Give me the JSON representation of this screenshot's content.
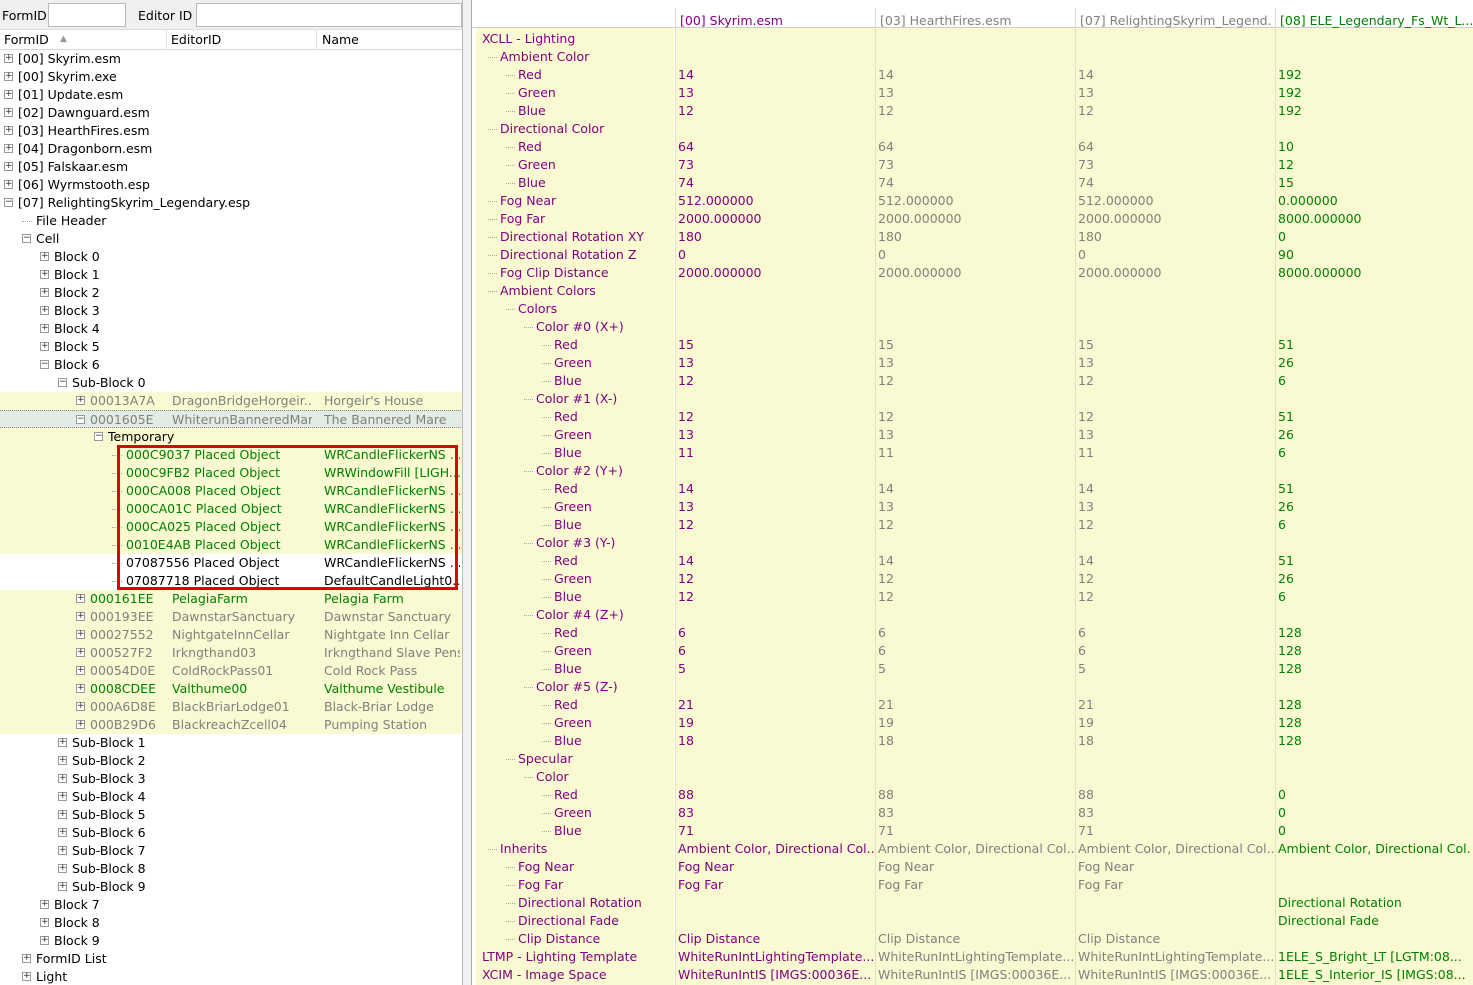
{
  "filter": {
    "formid_label": "FormID",
    "editorid_label": "Editor ID",
    "formid_value": "",
    "editorid_value": ""
  },
  "left_header": {
    "formid": "FormID",
    "editorid": "EditorID",
    "name": "Name"
  },
  "tree": [
    {
      "t": "p",
      "d": 0,
      "text": "[00] Skyrim.esm"
    },
    {
      "t": "p",
      "d": 0,
      "text": "[00] Skyrim.exe"
    },
    {
      "t": "p",
      "d": 0,
      "text": "[01] Update.esm"
    },
    {
      "t": "p",
      "d": 0,
      "text": "[02] Dawnguard.esm"
    },
    {
      "t": "p",
      "d": 0,
      "text": "[03] HearthFires.esm"
    },
    {
      "t": "p",
      "d": 0,
      "text": "[04] Dragonborn.esm"
    },
    {
      "t": "p",
      "d": 0,
      "text": "[05] Falskaar.esm"
    },
    {
      "t": "p",
      "d": 0,
      "text": "[06] Wyrmstooth.esp"
    },
    {
      "t": "m",
      "d": 0,
      "text": "[07] RelightingSkyrim_Legendary.esp"
    },
    {
      "t": "n",
      "d": 1,
      "text": "File Header"
    },
    {
      "t": "m",
      "d": 1,
      "text": "Cell"
    },
    {
      "t": "p",
      "d": 2,
      "text": "Block 0"
    },
    {
      "t": "p",
      "d": 2,
      "text": "Block 1"
    },
    {
      "t": "p",
      "d": 2,
      "text": "Block 2"
    },
    {
      "t": "p",
      "d": 2,
      "text": "Block 3"
    },
    {
      "t": "p",
      "d": 2,
      "text": "Block 4"
    },
    {
      "t": "p",
      "d": 2,
      "text": "Block 5"
    },
    {
      "t": "m",
      "d": 2,
      "text": "Block 6"
    },
    {
      "t": "m",
      "d": 3,
      "text": "Sub-Block 0"
    },
    {
      "t": "p",
      "d": 4,
      "text": "00013A7A",
      "c2": "DragonBridgeHorgeir...",
      "c3": "Horgeir's House",
      "col": "gray",
      "hl": true
    },
    {
      "t": "m",
      "d": 4,
      "text": "0001605E",
      "c2": "WhiterunBanneredMare",
      "c3": "The Bannered Mare",
      "col": "gray",
      "sel": true
    },
    {
      "t": "m",
      "d": 5,
      "text": "Temporary",
      "hl": true
    },
    {
      "t": "n",
      "d": 6,
      "text": "000C9037  Placed Object",
      "c3": "WRCandleFlickerNS ...",
      "col": "green",
      "hl": true
    },
    {
      "t": "n",
      "d": 6,
      "text": "000C9FB2  Placed Object",
      "c3": "WRWindowFill [LIGH...",
      "col": "green",
      "hl": true
    },
    {
      "t": "n",
      "d": 6,
      "text": "000CA008  Placed Object",
      "c3": "WRCandleFlickerNS ...",
      "col": "green",
      "hl": true
    },
    {
      "t": "n",
      "d": 6,
      "text": "000CA01C  Placed Object",
      "c3": "WRCandleFlickerNS ...",
      "col": "green",
      "hl": true
    },
    {
      "t": "n",
      "d": 6,
      "text": "000CA025  Placed Object",
      "c3": "WRCandleFlickerNS ...",
      "col": "green",
      "hl": true
    },
    {
      "t": "n",
      "d": 6,
      "text": "0010E4AB  Placed Object",
      "c3": "WRCandleFlickerNS ...",
      "col": "green",
      "hl": true
    },
    {
      "t": "n",
      "d": 6,
      "text": "07087556  Placed Object",
      "c3": "WRCandleFlickerNS ..."
    },
    {
      "t": "n",
      "d": 6,
      "text": "07087718  Placed Object",
      "c3": "DefaultCandleLight0..."
    },
    {
      "t": "p",
      "d": 4,
      "text": "000161EE",
      "c2": "PelagiaFarm",
      "c3": "Pelagia Farm",
      "col": "green",
      "hl": true
    },
    {
      "t": "p",
      "d": 4,
      "text": "000193EE",
      "c2": "DawnstarSanctuary",
      "c3": "Dawnstar Sanctuary",
      "col": "gray",
      "hl": true
    },
    {
      "t": "p",
      "d": 4,
      "text": "00027552",
      "c2": "NightgateInnCellar",
      "c3": "Nightgate Inn Cellar",
      "col": "gray",
      "hl": true
    },
    {
      "t": "p",
      "d": 4,
      "text": "000527F2",
      "c2": "Irkngthand03",
      "c3": "Irkngthand Slave Pens",
      "col": "gray",
      "hl": true
    },
    {
      "t": "p",
      "d": 4,
      "text": "00054D0E",
      "c2": "ColdRockPass01",
      "c3": "Cold Rock Pass",
      "col": "gray",
      "hl": true
    },
    {
      "t": "p",
      "d": 4,
      "text": "0008CDEE",
      "c2": "Valthume00",
      "c3": "Valthume Vestibule",
      "col": "green",
      "hl": true
    },
    {
      "t": "p",
      "d": 4,
      "text": "000A6D8E",
      "c2": "BlackBriarLodge01",
      "c3": "Black-Briar Lodge",
      "col": "gray",
      "hl": true
    },
    {
      "t": "p",
      "d": 4,
      "text": "000B29D6",
      "c2": "BlackreachZcell04",
      "c3": "Pumping Station",
      "col": "gray",
      "hl": true
    },
    {
      "t": "p",
      "d": 3,
      "text": "Sub-Block 1"
    },
    {
      "t": "p",
      "d": 3,
      "text": "Sub-Block 2"
    },
    {
      "t": "p",
      "d": 3,
      "text": "Sub-Block 3"
    },
    {
      "t": "p",
      "d": 3,
      "text": "Sub-Block 4"
    },
    {
      "t": "p",
      "d": 3,
      "text": "Sub-Block 5"
    },
    {
      "t": "p",
      "d": 3,
      "text": "Sub-Block 6"
    },
    {
      "t": "p",
      "d": 3,
      "text": "Sub-Block 7"
    },
    {
      "t": "p",
      "d": 3,
      "text": "Sub-Block 8"
    },
    {
      "t": "p",
      "d": 3,
      "text": "Sub-Block 9"
    },
    {
      "t": "p",
      "d": 2,
      "text": "Block 7"
    },
    {
      "t": "p",
      "d": 2,
      "text": "Block 8"
    },
    {
      "t": "p",
      "d": 2,
      "text": "Block 9"
    },
    {
      "t": "p",
      "d": 1,
      "text": "FormID List"
    },
    {
      "t": "p",
      "d": 1,
      "text": "Light"
    }
  ],
  "right_header": [
    "[00] Skyrim.esm",
    "[03] HearthFires.esm",
    "[07] RelightingSkyrim_Legend...",
    "[08] ELE_Legendary_Fs_Wt_L..."
  ],
  "right_header_colors": [
    "#800080",
    "#808080",
    "#808080",
    "#008000"
  ],
  "grid": [
    {
      "d": 0,
      "name": "XCLL - Lighting",
      "v": [
        "",
        "",
        "",
        ""
      ]
    },
    {
      "d": 1,
      "name": "Ambient Color",
      "v": [
        "",
        "",
        "",
        ""
      ]
    },
    {
      "d": 2,
      "name": "Red",
      "v": [
        "14",
        "14",
        "14",
        "192"
      ]
    },
    {
      "d": 2,
      "name": "Green",
      "v": [
        "13",
        "13",
        "13",
        "192"
      ]
    },
    {
      "d": 2,
      "name": "Blue",
      "v": [
        "12",
        "12",
        "12",
        "192"
      ]
    },
    {
      "d": 1,
      "name": "Directional Color",
      "v": [
        "",
        "",
        "",
        ""
      ]
    },
    {
      "d": 2,
      "name": "Red",
      "v": [
        "64",
        "64",
        "64",
        "10"
      ]
    },
    {
      "d": 2,
      "name": "Green",
      "v": [
        "73",
        "73",
        "73",
        "12"
      ]
    },
    {
      "d": 2,
      "name": "Blue",
      "v": [
        "74",
        "74",
        "74",
        "15"
      ]
    },
    {
      "d": 1,
      "name": "Fog Near",
      "v": [
        "512.000000",
        "512.000000",
        "512.000000",
        "0.000000"
      ]
    },
    {
      "d": 1,
      "name": "Fog Far",
      "v": [
        "2000.000000",
        "2000.000000",
        "2000.000000",
        "8000.000000"
      ]
    },
    {
      "d": 1,
      "name": "Directional Rotation XY",
      "v": [
        "180",
        "180",
        "180",
        "0"
      ]
    },
    {
      "d": 1,
      "name": "Directional Rotation Z",
      "v": [
        "0",
        "0",
        "0",
        "90"
      ]
    },
    {
      "d": 1,
      "name": "Fog Clip Distance",
      "v": [
        "2000.000000",
        "2000.000000",
        "2000.000000",
        "8000.000000"
      ]
    },
    {
      "d": 1,
      "name": "Ambient Colors",
      "v": [
        "",
        "",
        "",
        ""
      ]
    },
    {
      "d": 2,
      "name": "Colors",
      "v": [
        "",
        "",
        "",
        ""
      ]
    },
    {
      "d": 3,
      "name": "Color #0 (X+)",
      "v": [
        "",
        "",
        "",
        ""
      ]
    },
    {
      "d": 4,
      "name": "Red",
      "v": [
        "15",
        "15",
        "15",
        "51"
      ]
    },
    {
      "d": 4,
      "name": "Green",
      "v": [
        "13",
        "13",
        "13",
        "26"
      ]
    },
    {
      "d": 4,
      "name": "Blue",
      "v": [
        "12",
        "12",
        "12",
        "6"
      ]
    },
    {
      "d": 3,
      "name": "Color #1 (X-)",
      "v": [
        "",
        "",
        "",
        ""
      ]
    },
    {
      "d": 4,
      "name": "Red",
      "v": [
        "12",
        "12",
        "12",
        "51"
      ]
    },
    {
      "d": 4,
      "name": "Green",
      "v": [
        "13",
        "13",
        "13",
        "26"
      ]
    },
    {
      "d": 4,
      "name": "Blue",
      "v": [
        "11",
        "11",
        "11",
        "6"
      ]
    },
    {
      "d": 3,
      "name": "Color #2 (Y+)",
      "v": [
        "",
        "",
        "",
        ""
      ]
    },
    {
      "d": 4,
      "name": "Red",
      "v": [
        "14",
        "14",
        "14",
        "51"
      ]
    },
    {
      "d": 4,
      "name": "Green",
      "v": [
        "13",
        "13",
        "13",
        "26"
      ]
    },
    {
      "d": 4,
      "name": "Blue",
      "v": [
        "12",
        "12",
        "12",
        "6"
      ]
    },
    {
      "d": 3,
      "name": "Color #3 (Y-)",
      "v": [
        "",
        "",
        "",
        ""
      ]
    },
    {
      "d": 4,
      "name": "Red",
      "v": [
        "14",
        "14",
        "14",
        "51"
      ]
    },
    {
      "d": 4,
      "name": "Green",
      "v": [
        "12",
        "12",
        "12",
        "26"
      ]
    },
    {
      "d": 4,
      "name": "Blue",
      "v": [
        "12",
        "12",
        "12",
        "6"
      ]
    },
    {
      "d": 3,
      "name": "Color #4 (Z+)",
      "v": [
        "",
        "",
        "",
        ""
      ]
    },
    {
      "d": 4,
      "name": "Red",
      "v": [
        "6",
        "6",
        "6",
        "128"
      ]
    },
    {
      "d": 4,
      "name": "Green",
      "v": [
        "6",
        "6",
        "6",
        "128"
      ]
    },
    {
      "d": 4,
      "name": "Blue",
      "v": [
        "5",
        "5",
        "5",
        "128"
      ]
    },
    {
      "d": 3,
      "name": "Color #5 (Z-)",
      "v": [
        "",
        "",
        "",
        ""
      ]
    },
    {
      "d": 4,
      "name": "Red",
      "v": [
        "21",
        "21",
        "21",
        "128"
      ]
    },
    {
      "d": 4,
      "name": "Green",
      "v": [
        "19",
        "19",
        "19",
        "128"
      ]
    },
    {
      "d": 4,
      "name": "Blue",
      "v": [
        "18",
        "18",
        "18",
        "128"
      ]
    },
    {
      "d": 2,
      "name": "Specular",
      "v": [
        "",
        "",
        "",
        ""
      ]
    },
    {
      "d": 3,
      "name": "Color",
      "v": [
        "",
        "",
        "",
        ""
      ]
    },
    {
      "d": 4,
      "name": "Red",
      "v": [
        "88",
        "88",
        "88",
        "0"
      ]
    },
    {
      "d": 4,
      "name": "Green",
      "v": [
        "83",
        "83",
        "83",
        "0"
      ]
    },
    {
      "d": 4,
      "name": "Blue",
      "v": [
        "71",
        "71",
        "71",
        "0"
      ]
    },
    {
      "d": 1,
      "name": "Inherits",
      "v": [
        "Ambient Color, Directional Col...",
        "Ambient Color, Directional Col...",
        "Ambient Color, Directional Col...",
        "Ambient Color, Directional Col..."
      ]
    },
    {
      "d": 2,
      "name": "Fog Near",
      "v": [
        "Fog Near",
        "Fog Near",
        "Fog Near",
        ""
      ]
    },
    {
      "d": 2,
      "name": "Fog Far",
      "v": [
        "Fog Far",
        "Fog Far",
        "Fog Far",
        ""
      ]
    },
    {
      "d": 2,
      "name": "Directional Rotation",
      "v": [
        "",
        "",
        "",
        "Directional Rotation"
      ]
    },
    {
      "d": 2,
      "name": "Directional Fade",
      "v": [
        "",
        "",
        "",
        "Directional Fade"
      ]
    },
    {
      "d": 2,
      "name": "Clip Distance",
      "v": [
        "Clip Distance",
        "Clip Distance",
        "Clip Distance",
        ""
      ]
    },
    {
      "d": 0,
      "name": "LTMP - Lighting Template",
      "v": [
        "WhiteRunIntLightingTemplate...",
        "WhiteRunIntLightingTemplate...",
        "WhiteRunIntLightingTemplate...",
        "1ELE_S_Bright_LT [LGTM:08..."
      ]
    },
    {
      "d": 0,
      "name": "XCIM - Image Space",
      "v": [
        "WhiteRunIntIS [IMGS:00036E...",
        "WhiteRunIntIS [IMGS:00036E...",
        "WhiteRunIntIS [IMGS:00036E...",
        "1ELE_S_Interior_IS [IMGS:08..."
      ]
    }
  ],
  "colors": {
    "purple": "#800080",
    "green": "#008000",
    "gray": "#808080",
    "highlight": "#fafad2",
    "red_box": "#e00000"
  }
}
